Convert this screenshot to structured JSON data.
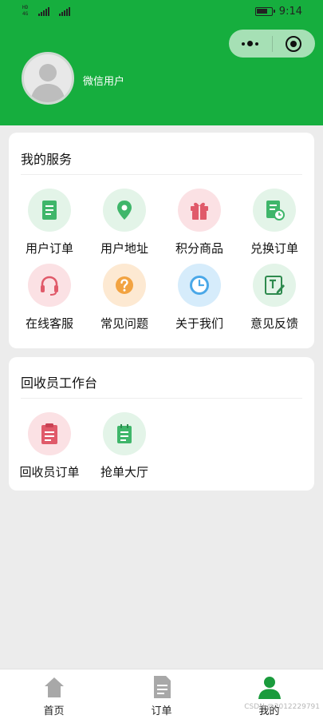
{
  "status_bar": {
    "time": "9:14",
    "left_tiny_1": "HD",
    "left_tiny_2": "4G"
  },
  "capsule": {
    "more_icon": "more-dots-icon",
    "close_icon": "target-close-icon"
  },
  "profile": {
    "nickname": "微信用户"
  },
  "services": {
    "title": "我的服务",
    "items": [
      {
        "label": "用户订单",
        "icon": "document-icon",
        "color": "#3fb66a",
        "bg": "#e3f4e8"
      },
      {
        "label": "用户地址",
        "icon": "location-pin-icon",
        "color": "#3fb66a",
        "bg": "#e3f4e8"
      },
      {
        "label": "积分商品",
        "icon": "gift-icon",
        "color": "#e05a6a",
        "bg": "#fbe1e4"
      },
      {
        "label": "兑换订单",
        "icon": "order-clock-icon",
        "color": "#3fb66a",
        "bg": "#e3f4e8"
      },
      {
        "label": "在线客服",
        "icon": "headset-icon",
        "color": "#e05a6a",
        "bg": "#fbe1e4"
      },
      {
        "label": "常见问题",
        "icon": "question-icon",
        "color": "#f2a341",
        "bg": "#fde9d2"
      },
      {
        "label": "关于我们",
        "icon": "clock-icon",
        "color": "#4aa8e8",
        "bg": "#d6ecfb"
      },
      {
        "label": "意见反馈",
        "icon": "feedback-edit-icon",
        "color": "#3fb66a",
        "bg": "#e3f4e8"
      }
    ]
  },
  "workbench": {
    "title": "回收员工作台",
    "items": [
      {
        "label": "回收员订单",
        "icon": "clipboard-icon",
        "color": "#e05a6a",
        "bg": "#fbe1e4"
      },
      {
        "label": "抢单大厅",
        "icon": "notepad-icon",
        "color": "#3fb66a",
        "bg": "#e3f4e8"
      }
    ]
  },
  "tabbar": {
    "items": [
      {
        "label": "首页",
        "icon": "home-icon",
        "active": false
      },
      {
        "label": "订单",
        "icon": "order-list-icon",
        "active": false
      },
      {
        "label": "我的",
        "icon": "user-icon",
        "active": true
      }
    ]
  },
  "watermark": "CSDN @2012229791",
  "colors": {
    "brand_green": "#16ae3e",
    "active_tab": "#1a9b3c",
    "inactive_tab": "#a8a8a8"
  }
}
